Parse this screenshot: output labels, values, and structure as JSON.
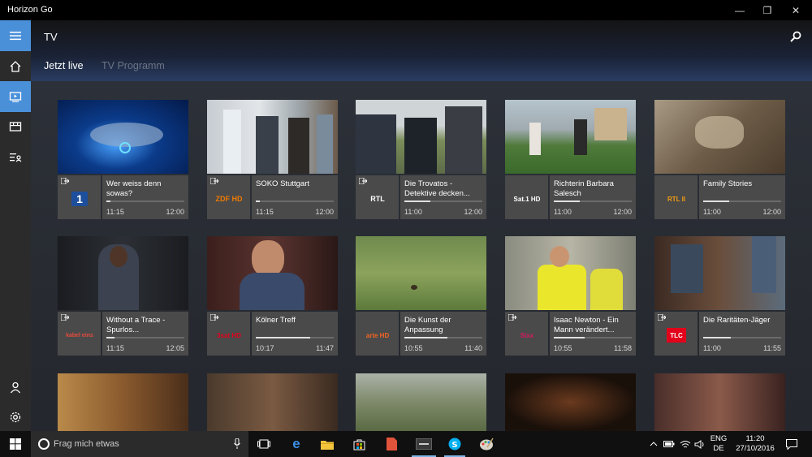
{
  "window": {
    "title": "Horizon Go",
    "minimize_glyph": "—",
    "maximize_glyph": "❐",
    "close_glyph": "✕"
  },
  "sidebar": {
    "items": [
      {
        "name": "hamburger-menu",
        "icon": "hamburger-icon"
      },
      {
        "name": "home",
        "icon": "home-icon"
      },
      {
        "name": "tv",
        "icon": "tv-icon"
      },
      {
        "name": "recordings",
        "icon": "film-icon"
      },
      {
        "name": "my-list",
        "icon": "list-icon"
      },
      {
        "name": "profile",
        "icon": "user-icon"
      },
      {
        "name": "settings",
        "icon": "gear-icon"
      }
    ]
  },
  "header": {
    "title": "TV",
    "tabs": [
      {
        "label": "Jetzt live",
        "active": true
      },
      {
        "label": "TV Programm",
        "active": false
      }
    ]
  },
  "colors": {
    "accent": "#4a90d9",
    "card_bg": "#4a4a4a"
  },
  "channels": [
    {
      "logo": "1",
      "logo_color": "#1d4f9c",
      "title": "Wer weiss denn sowas?",
      "start": "11:15",
      "end": "12:00",
      "progress": 0.05
    },
    {
      "logo": "ZDF HD",
      "logo_color": "#f07a00",
      "title": "SOKO Stuttgart",
      "start": "11:15",
      "end": "12:00",
      "progress": 0.05
    },
    {
      "logo": "RTL",
      "logo_color": "#e2001a",
      "title": "Die Trovatos - Detektive decken...",
      "start": "11:00",
      "end": "12:00",
      "progress": 0.33
    },
    {
      "logo": "Sat.1 HD",
      "logo_color": "#d01c77",
      "title": "Richterin Barbara Salesch",
      "start": "11:00",
      "end": "12:00",
      "progress": 0.33
    },
    {
      "logo": "RTL II",
      "logo_color": "#f39c12",
      "title": "Family Stories",
      "start": "11:00",
      "end": "12:00",
      "progress": 0.33
    },
    {
      "logo": "kabel eins",
      "logo_color": "#e74c3c",
      "title": "Without a Trace - Spurlos...",
      "start": "11:15",
      "end": "12:05",
      "progress": 0.1
    },
    {
      "logo": "3sat HD",
      "logo_color": "#e2001a",
      "title": "Kölner Treff",
      "start": "10:17",
      "end": "11:47",
      "progress": 0.7
    },
    {
      "logo": "arte HD",
      "logo_color": "#f26522",
      "title": "Die Kunst der Anpassung",
      "start": "10:55",
      "end": "11:40",
      "progress": 0.55
    },
    {
      "logo": "Sixx",
      "logo_color": "#d81b60",
      "title": "Isaac Newton - Ein Mann verändert...",
      "start": "10:55",
      "end": "11:58",
      "progress": 0.4
    },
    {
      "logo": "TLC",
      "logo_color": "#e2001a",
      "title": "Die Raritäten-Jäger",
      "start": "11:00",
      "end": "11:55",
      "progress": 0.35
    }
  ],
  "taskbar": {
    "search_placeholder": "Frag mich etwas",
    "language_line1": "ENG",
    "language_line2": "DE",
    "time": "11:20",
    "date": "27/10/2016"
  }
}
